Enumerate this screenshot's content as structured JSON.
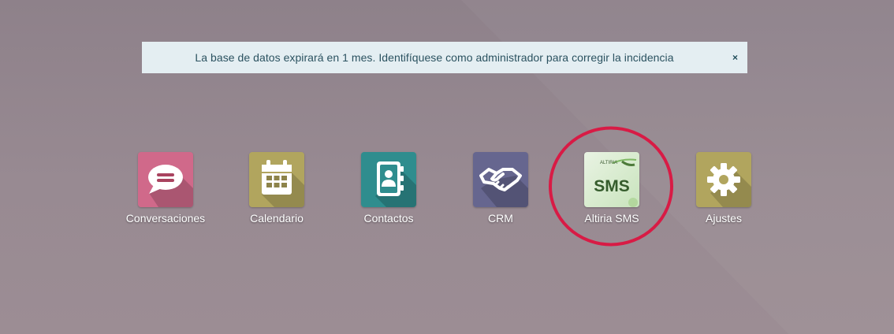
{
  "notification": {
    "message": "La base de datos expirará en 1 mes. Identifíquese como administrador para corregir la incidencia",
    "close_symbol": "×"
  },
  "apps": [
    {
      "label": "Conversaciones",
      "icon": "chat-bubble-icon",
      "color": "#d0698a"
    },
    {
      "label": "Calendario",
      "icon": "calendar-icon",
      "color": "#b1a55e"
    },
    {
      "label": "Contactos",
      "icon": "contact-book-icon",
      "color": "#2f8d8e"
    },
    {
      "label": "CRM",
      "icon": "handshake-icon",
      "color": "#66668f"
    },
    {
      "label": "Altiria SMS",
      "icon": "altiria-sms-logo",
      "color": "#d7ecd0",
      "logo_text": "SMS",
      "logo_brand": "ALTIRIA"
    },
    {
      "label": "Ajustes",
      "icon": "gear-icon",
      "color": "#b1a55e"
    }
  ],
  "highlight": {
    "target": "Altiria SMS",
    "color": "#d81b45"
  }
}
